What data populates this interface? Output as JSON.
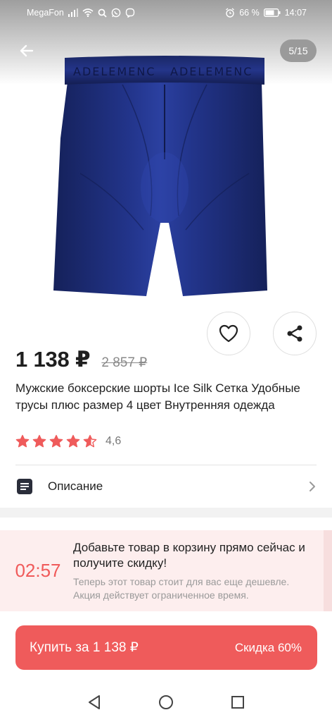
{
  "status_bar": {
    "carrier": "MegaFon",
    "battery": "66 %",
    "time": "14:07"
  },
  "gallery": {
    "counter": "5/15",
    "waistband_text": "ADELEMENC"
  },
  "product": {
    "price": "1 138 ₽",
    "old_price": "2 857 ₽",
    "title": "Мужские боксерские шорты Ice Silk Сетка Удобные трусы плюс размер 4 цвет Внутренняя одежда",
    "rating": "4,6",
    "rating_value": 4.6,
    "rating_max": 5
  },
  "description": {
    "label": "Описание"
  },
  "promo": {
    "timer": "02:57",
    "title": "Добавьте товар в корзину прямо сейчас и получите скидку!",
    "subtitle": "Теперь этот товар стоит для вас еще дешевле. Акция действует ограниченное время."
  },
  "buy": {
    "label": "Купить за 1 138 ₽",
    "discount": "Скидка 60%"
  },
  "colors": {
    "accent": "#ef5b5b",
    "star": "#ef5b5b",
    "promo_bg": "#fdeeee",
    "product_navy": "#1b2a6e"
  }
}
